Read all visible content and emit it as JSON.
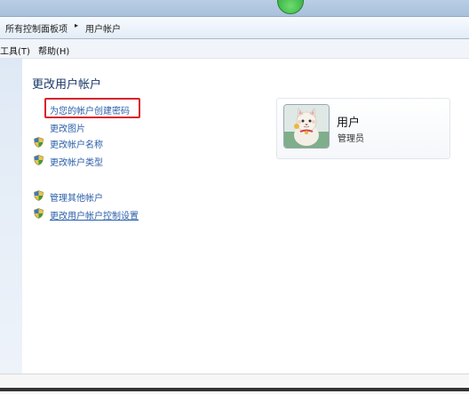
{
  "breadcrumb": {
    "root": "所有控制面板项",
    "separator": "▸",
    "current": "用户帐户"
  },
  "menu": {
    "tools": "工具(T)",
    "help": "帮助(H)"
  },
  "page": {
    "title": "更改用户帐户"
  },
  "tasks": {
    "create_password": "为您的帐户创建密码",
    "change_picture": "更改图片",
    "change_name": "更改帐户名称",
    "change_type": "更改帐户类型",
    "manage_other": "管理其他帐户",
    "uac_settings": "更改用户帐户控制设置"
  },
  "user": {
    "name": "用户",
    "role": "管理员"
  },
  "colors": {
    "link": "#2a5ea8",
    "highlight": "#d8232a",
    "title": "#1c3a6a"
  },
  "icons": {
    "shield": "uac-shield-icon",
    "avatar": "cat-figurine-avatar"
  }
}
